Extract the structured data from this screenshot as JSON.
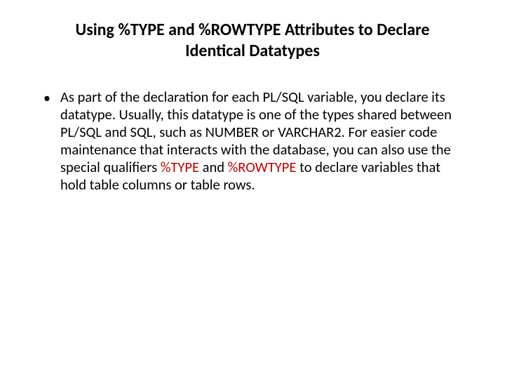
{
  "title": "Using %TYPE and %ROWTYPE Attributes to Declare Identical Datatypes",
  "bullet": {
    "p1": "As part of the declaration for each PL/SQL variable, you declare its datatype. Usually, this datatype is one of the types shared between PL/SQL and SQL, such as NUMBER or VARCHAR2. For easier code maintenance that interacts with the database, you can also use the special qualifiers ",
    "kw1": "%TYPE",
    "p2": " and ",
    "kw2": "%ROWTYPE",
    "p3": " to declare variables that hold table columns or table rows."
  }
}
